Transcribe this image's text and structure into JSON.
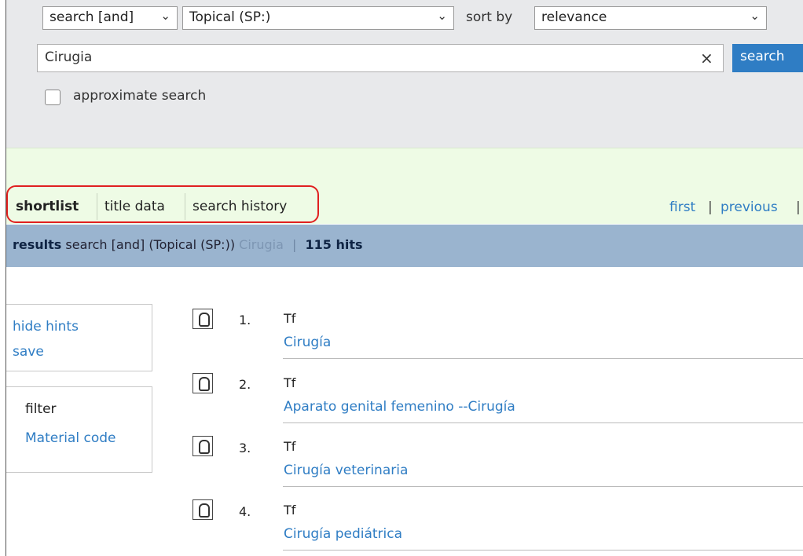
{
  "search": {
    "operator_select": "search [and]",
    "index_select": "Topical (SP:)",
    "sort_label": "sort by",
    "sort_select": "relevance",
    "query": "Cirugia",
    "clear_icon": "×",
    "search_button": "search",
    "approximate_label": "approximate search",
    "approximate_checked": false
  },
  "tabs": [
    {
      "label": "shortlist",
      "active": true
    },
    {
      "label": "title data"
    },
    {
      "label": "search history"
    }
  ],
  "pager": {
    "first": "first",
    "previous": "previous"
  },
  "results_bar": {
    "label": "results",
    "query_desc": "search [and]  (Topical (SP:))",
    "term": "Cirugia",
    "hits": "115 hits"
  },
  "sidebar": {
    "hide_hints": "hide hints",
    "save": "save",
    "filter_label": "filter",
    "material_code": "Material code"
  },
  "results": [
    {
      "number": "1.",
      "type": "Tf",
      "title": "Cirugía"
    },
    {
      "number": "2.",
      "type": "Tf",
      "title": "Aparato genital femenino --Cirugía"
    },
    {
      "number": "3.",
      "type": "Tf",
      "title": "Cirugía veterinaria"
    },
    {
      "number": "4.",
      "type": "Tf",
      "title": "Cirugía pediátrica"
    }
  ],
  "colors": {
    "accent": "#2f7dc4",
    "results_bar": "#9ab4cf",
    "highlight_oval": "#e02020"
  }
}
